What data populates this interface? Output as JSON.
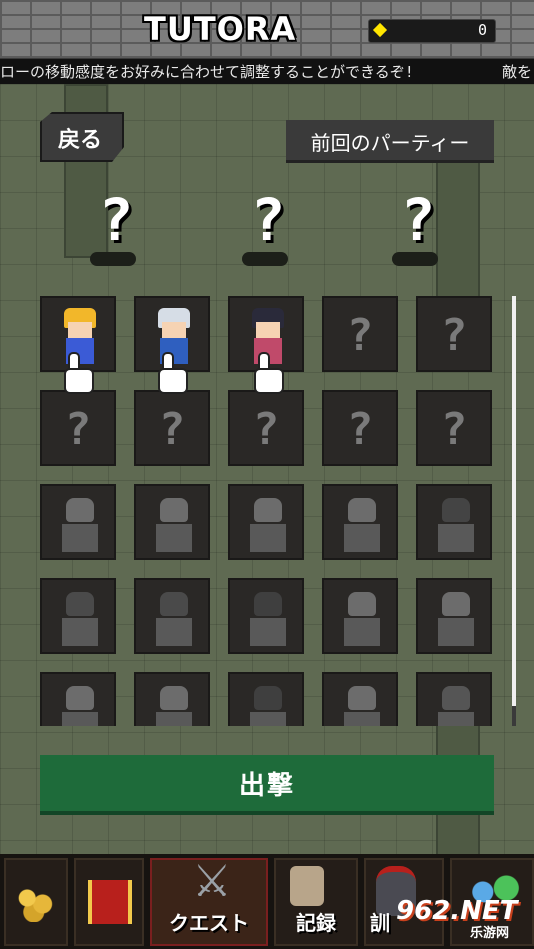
{
  "header": {
    "title": "TUTORA",
    "gem_count": "0",
    "ticker_main": "ローの移動感度をお好みに合わせて調整することができるぞ!",
    "ticker_next": "敵を"
  },
  "party": {
    "back_label": "戻る",
    "previous_party_label": "前回のパーティー",
    "slots": [
      "?",
      "?",
      "?"
    ]
  },
  "roster": {
    "unknown_mark": "?",
    "heroes": [
      {
        "hair": "#f2b72a",
        "body": "#3b5bd6"
      },
      {
        "hair": "#d6dde6",
        "body": "#2f5fbf"
      },
      {
        "hair": "#2a2a3a",
        "body": "#c04a6a"
      }
    ]
  },
  "sortie_label": "出撃",
  "nav": {
    "quest": "クエスト",
    "records": "記録",
    "training": "訓"
  },
  "watermark": {
    "brand": "962.NET",
    "sub": "乐游网"
  },
  "colors": {
    "sortie": "#1e6b3a",
    "gem": "#ffe500"
  }
}
